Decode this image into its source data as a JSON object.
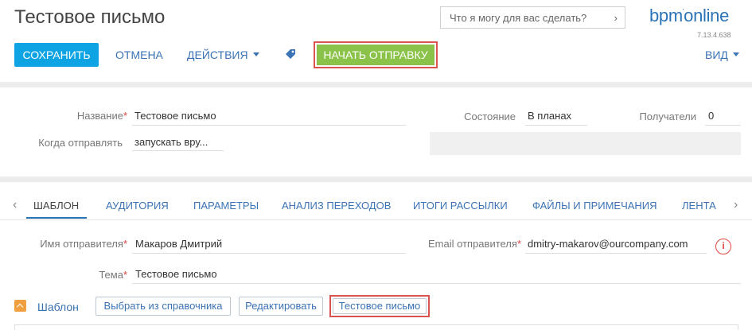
{
  "header": {
    "title": "Тестовое письмо",
    "search_placeholder": "Что я могу для вас сделать?",
    "logo_text": "bpm",
    "logo_sup": "'",
    "logo_text2": "online",
    "version": "7.13.4.638"
  },
  "toolbar": {
    "save_label": "СОХРАНИТЬ",
    "cancel_label": "ОТМЕНА",
    "actions_label": "ДЕЙСТВИЯ",
    "start_label": "НАЧАТЬ ОТПРАВКУ",
    "view_label": "ВИД"
  },
  "form": {
    "name_label": "Название",
    "name_value": "Тестовое письмо",
    "when_label": "Когда отправлять",
    "when_value": "запускать вру...",
    "state_label": "Состояние",
    "state_value": "В планах",
    "recipients_label": "Получатели",
    "recipients_value": "0"
  },
  "tabs": [
    {
      "label": "ШАБЛОН"
    },
    {
      "label": "АУДИТОРИЯ"
    },
    {
      "label": "ПАРАМЕТРЫ"
    },
    {
      "label": "АНАЛИЗ ПЕРЕХОДОВ"
    },
    {
      "label": "ИТОГИ РАССЫЛКИ"
    },
    {
      "label": "ФАЙЛЫ И ПРИМЕЧАНИЯ"
    },
    {
      "label": "ЛЕНТА"
    }
  ],
  "template_tab": {
    "sender_name_label": "Имя отправителя",
    "sender_name_value": "Макаров Дмитрий",
    "sender_email_label": "Email отправителя",
    "sender_email_value": "dmitry-makarov@ourcompany.com",
    "subject_label": "Тема",
    "subject_value": "Тестовое письмо",
    "section_title": "Шаблон",
    "btn_choose": "Выбрать из справочника",
    "btn_edit": "Редактировать",
    "btn_test": "Тестовое письмо"
  },
  "colors": {
    "accent": "#0ea4e4",
    "start_button": "#8bc34a",
    "link": "#3b73b4",
    "highlight": "#d9534f",
    "required": "#e0433f"
  }
}
